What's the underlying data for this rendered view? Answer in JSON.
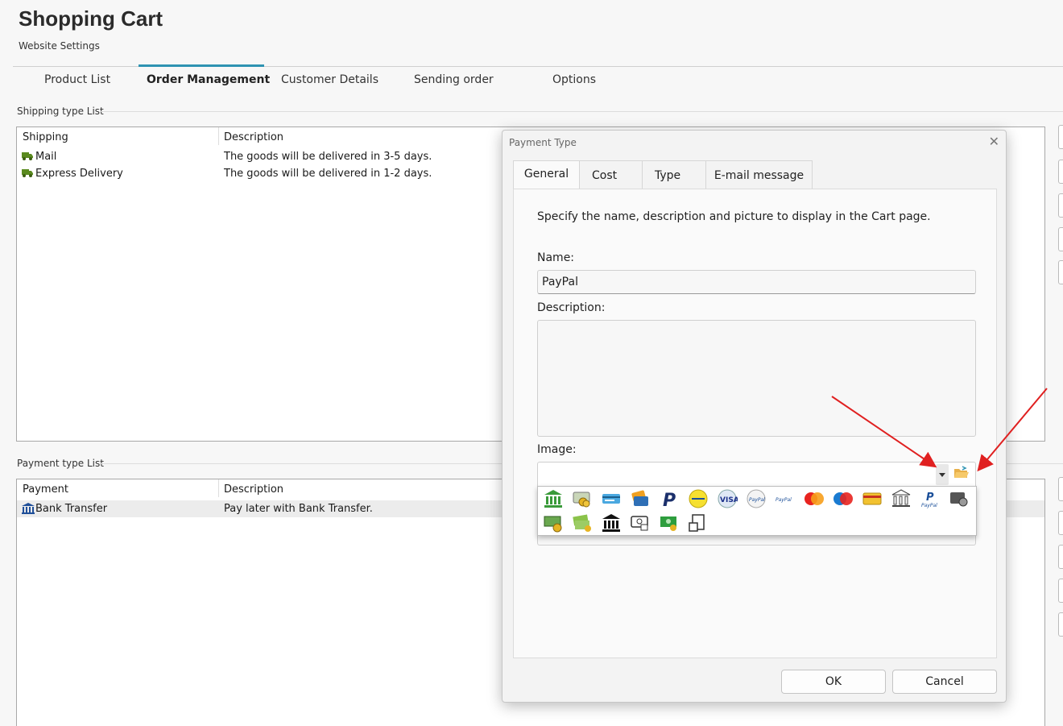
{
  "app": {
    "title": "Shopping Cart",
    "subtitle": "Website Settings"
  },
  "main_tabs": [
    {
      "label": "Product List"
    },
    {
      "label": "Order Management",
      "active": true
    },
    {
      "label": "Customer Details"
    },
    {
      "label": "Sending order"
    },
    {
      "label": "Options"
    }
  ],
  "shipping": {
    "section_label": "Shipping type List",
    "columns": [
      "Shipping",
      "Description"
    ],
    "rows": [
      {
        "name": "Mail",
        "description": "The goods will be delivered in 3-5 days.",
        "icon": "truck-icon"
      },
      {
        "name": "Express Delivery",
        "description": "The goods will be delivered in 1-2 days.",
        "icon": "truck-icon"
      }
    ]
  },
  "payment": {
    "section_label": "Payment type List",
    "columns": [
      "Payment",
      "Description"
    ],
    "rows": [
      {
        "name": "Bank Transfer",
        "description": "Pay later with Bank Transfer.",
        "icon": "bank-icon",
        "selected": true
      }
    ]
  },
  "dialog": {
    "title": "Payment Type",
    "close_glyph": "✕",
    "tabs": [
      {
        "label": "General",
        "active": true
      },
      {
        "label": "Cost"
      },
      {
        "label": "Type"
      },
      {
        "label": "E-mail message"
      }
    ],
    "intro": "Specify the name, description and picture to display in the Cart page.",
    "name_label": "Name:",
    "name_value": "PayPal",
    "description_label": "Description:",
    "description_value": "",
    "image_label": "Image:",
    "image_icons": [
      "bank-green-icon",
      "coins-card-icon",
      "credit-card-blue-icon",
      "card-wallet-icon",
      "paypal-p-icon",
      "postepay-icon",
      "visa-icon",
      "paypal-round-icon",
      "paypal-text-icon",
      "mastercard-icon",
      "maestro-icon",
      "gold-card-icon",
      "bank-outline-icon",
      "paypal-logo-icon",
      "wallet-coins-icon",
      "cash-coins-icon",
      "money-stack-icon",
      "bank-black-icon",
      "cash-lock-icon",
      "cash-green-icon",
      "cash-hand-icon"
    ],
    "ok_label": "OK",
    "cancel_label": "Cancel"
  },
  "colors": {
    "accent": "#2e93b2",
    "annotation_arrow": "#e02020",
    "truck": "#5a8a1f",
    "bank": "#1f4f99"
  }
}
